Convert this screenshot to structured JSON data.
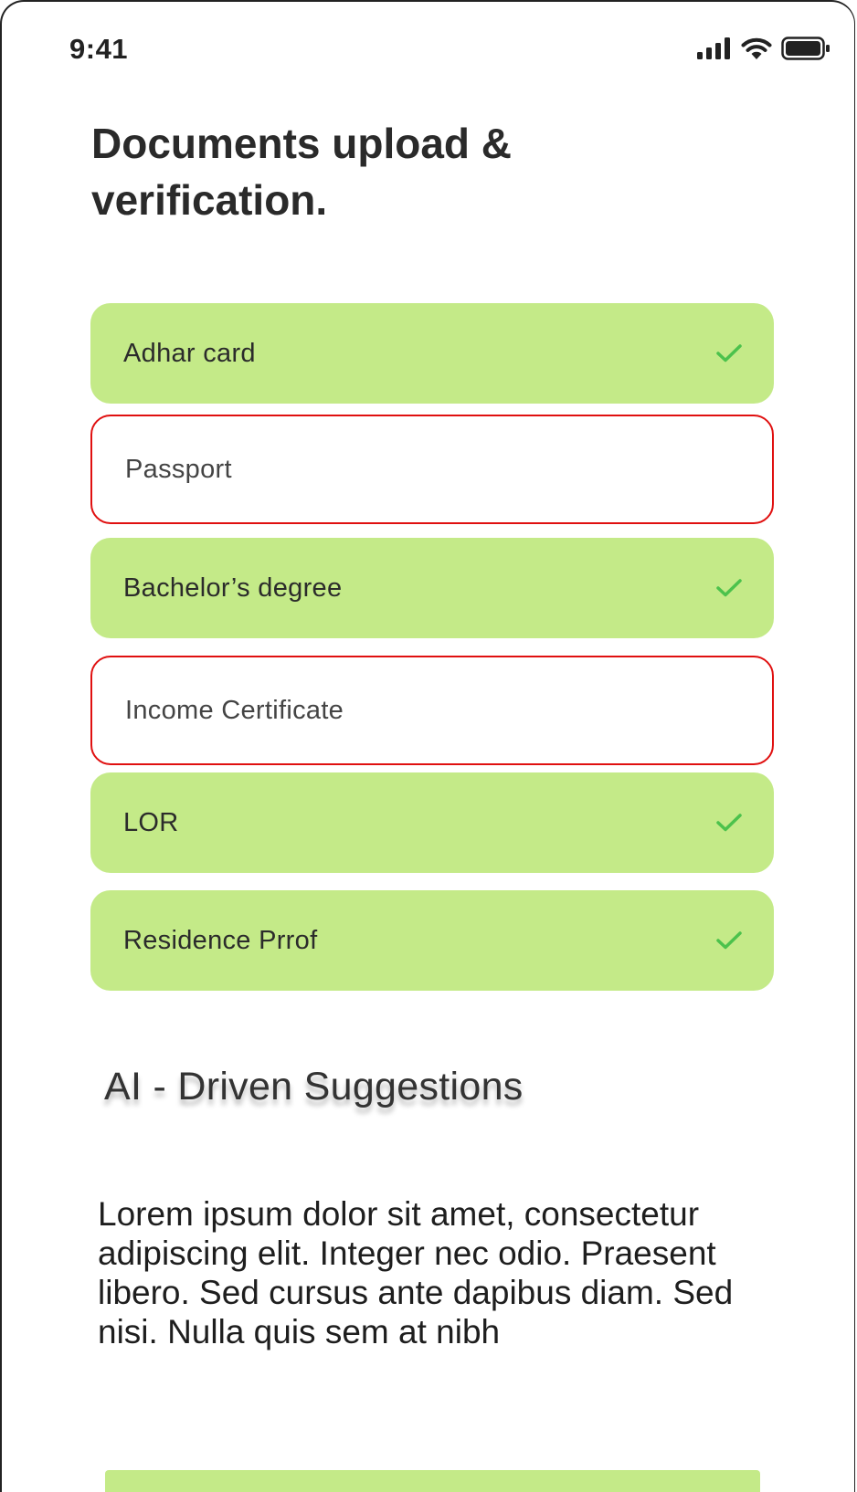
{
  "status_bar": {
    "time": "9:41",
    "icons": [
      "cellular-signal-icon",
      "wifi-icon",
      "battery-icon"
    ]
  },
  "page": {
    "title": "Documents upload & verification."
  },
  "documents": [
    {
      "label": "Adhar card",
      "status": "verified"
    },
    {
      "label": "Passport",
      "status": "pending"
    },
    {
      "label": "Bachelor’s degree",
      "status": "verified"
    },
    {
      "label": "Income Certificate",
      "status": "pending"
    },
    {
      "label": "LOR",
      "status": "verified"
    },
    {
      "label": "Residence Prrof",
      "status": "verified"
    }
  ],
  "ai_section": {
    "heading": "AI - Driven Suggestions",
    "body": "Lorem ipsum dolor sit amet, consectetur adipiscing elit. Integer nec odio. Praesent libero. Sed cursus ante dapibus diam. Sed nisi. Nulla quis sem at nibh"
  },
  "colors": {
    "verified_bg": "#c4ea88",
    "pending_border": "#e01010",
    "check_green": "#4cc24c"
  }
}
